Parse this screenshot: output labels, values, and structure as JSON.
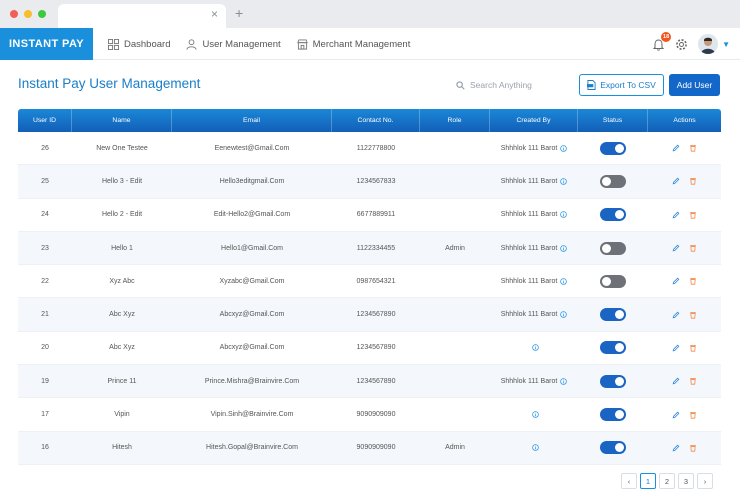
{
  "browser": {
    "close_glyph": "×",
    "new_tab_glyph": "+"
  },
  "header": {
    "brand": "INSTANT PAY",
    "nav": [
      {
        "label": "Dashboard",
        "icon": "dashboard-icon"
      },
      {
        "label": "User Management",
        "icon": "user-icon"
      },
      {
        "label": "Merchant Management",
        "icon": "store-icon"
      }
    ],
    "notification_count": "18",
    "accent": "#1a90dc"
  },
  "page": {
    "title": "Instant Pay User Management",
    "search_placeholder": "Search Anything",
    "export_label": "Export To CSV",
    "add_label": "Add User"
  },
  "table": {
    "columns": [
      "User ID",
      "Name",
      "Email",
      "Contact No.",
      "Role",
      "Created By",
      "Status",
      "Actions"
    ],
    "rows": [
      {
        "id": "26",
        "name": "New One Testee",
        "email": "Eenewtest@Gmail.Com",
        "contact": "1122778800",
        "role": "",
        "created_by": "Shhhlok 111 Barot",
        "status": true
      },
      {
        "id": "25",
        "name": "Hello 3 - Edit",
        "email": "Hello3editgmail.Com",
        "contact": "1234567833",
        "role": "",
        "created_by": "Shhhlok 111 Barot",
        "status": false
      },
      {
        "id": "24",
        "name": "Hello 2 - Edit",
        "email": "Edit-Hello2@Gmail.Com",
        "contact": "6677889911",
        "role": "",
        "created_by": "Shhhlok 111 Barot",
        "status": true
      },
      {
        "id": "23",
        "name": "Hello 1",
        "email": "Hello1@Gmail.Com",
        "contact": "1122334455",
        "role": "Admin",
        "created_by": "Shhhlok 111 Barot",
        "status": false
      },
      {
        "id": "22",
        "name": "Xyz Abc",
        "email": "Xyzabc@Gmail.Com",
        "contact": "0987654321",
        "role": "",
        "created_by": "Shhhlok 111 Barot",
        "status": false
      },
      {
        "id": "21",
        "name": "Abc Xyz",
        "email": "Abcxyz@Gmail.Com",
        "contact": "1234567890",
        "role": "",
        "created_by": "Shhhlok 111 Barot",
        "status": true
      },
      {
        "id": "20",
        "name": "Abc Xyz",
        "email": "Abcxyz@Gmail.Com",
        "contact": "1234567890",
        "role": "",
        "created_by": "",
        "status": true
      },
      {
        "id": "19",
        "name": "Prince 11",
        "email": "Prince.Mishra@Brainvire.Com",
        "contact": "1234567890",
        "role": "",
        "created_by": "Shhhlok 111 Barot",
        "status": true
      },
      {
        "id": "17",
        "name": "Vipin",
        "email": "Vipin.Sinh@Brainvire.Com",
        "contact": "9090909090",
        "role": "",
        "created_by": "",
        "status": true
      },
      {
        "id": "16",
        "name": "Hitesh",
        "email": "Hitesh.Gopal@Brainvire.Com",
        "contact": "9090909090",
        "role": "Admin",
        "created_by": "",
        "status": true
      }
    ]
  },
  "pagination": {
    "prev": "‹",
    "pages": [
      "1",
      "2",
      "3"
    ],
    "current": "1",
    "next": "›"
  }
}
